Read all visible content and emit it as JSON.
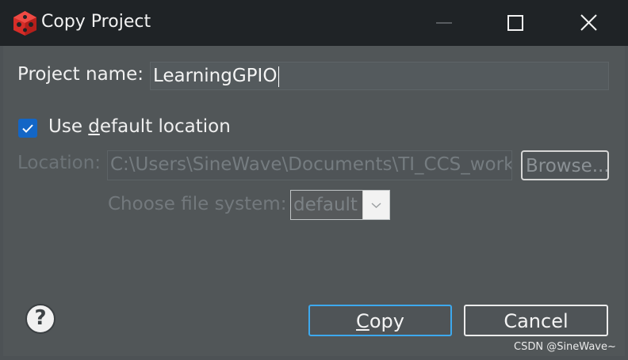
{
  "window": {
    "title": "Copy Project",
    "app_icon": "ti-ccs-cube-icon",
    "controls": [
      "minimize-icon",
      "maximize-icon",
      "close-icon"
    ]
  },
  "form": {
    "project_name_label": "Project name:",
    "project_name_value": "LearningGPIO",
    "use_default": {
      "checked": true,
      "label_prefix": "Use ",
      "label_mnemonic": "d",
      "label_suffix": "efault location"
    },
    "location_label": "Location:",
    "location_value": "C:\\Users\\SineWave\\Documents\\TI_CCS_workspace",
    "browse_label": "Browse...",
    "file_system_label": "Choose file system:",
    "file_system_value": "default"
  },
  "footer": {
    "help_icon": "help-question-icon",
    "help_glyph": "?",
    "copy_mnemonic": "C",
    "copy_rest": "opy",
    "cancel_label": "Cancel"
  },
  "watermark": "CSDN @SineWave~",
  "colors": {
    "titlebar": "#1f2326",
    "dialog_bg": "#515658",
    "accent": "#1366c6",
    "default_button_border": "#3da9ee"
  }
}
